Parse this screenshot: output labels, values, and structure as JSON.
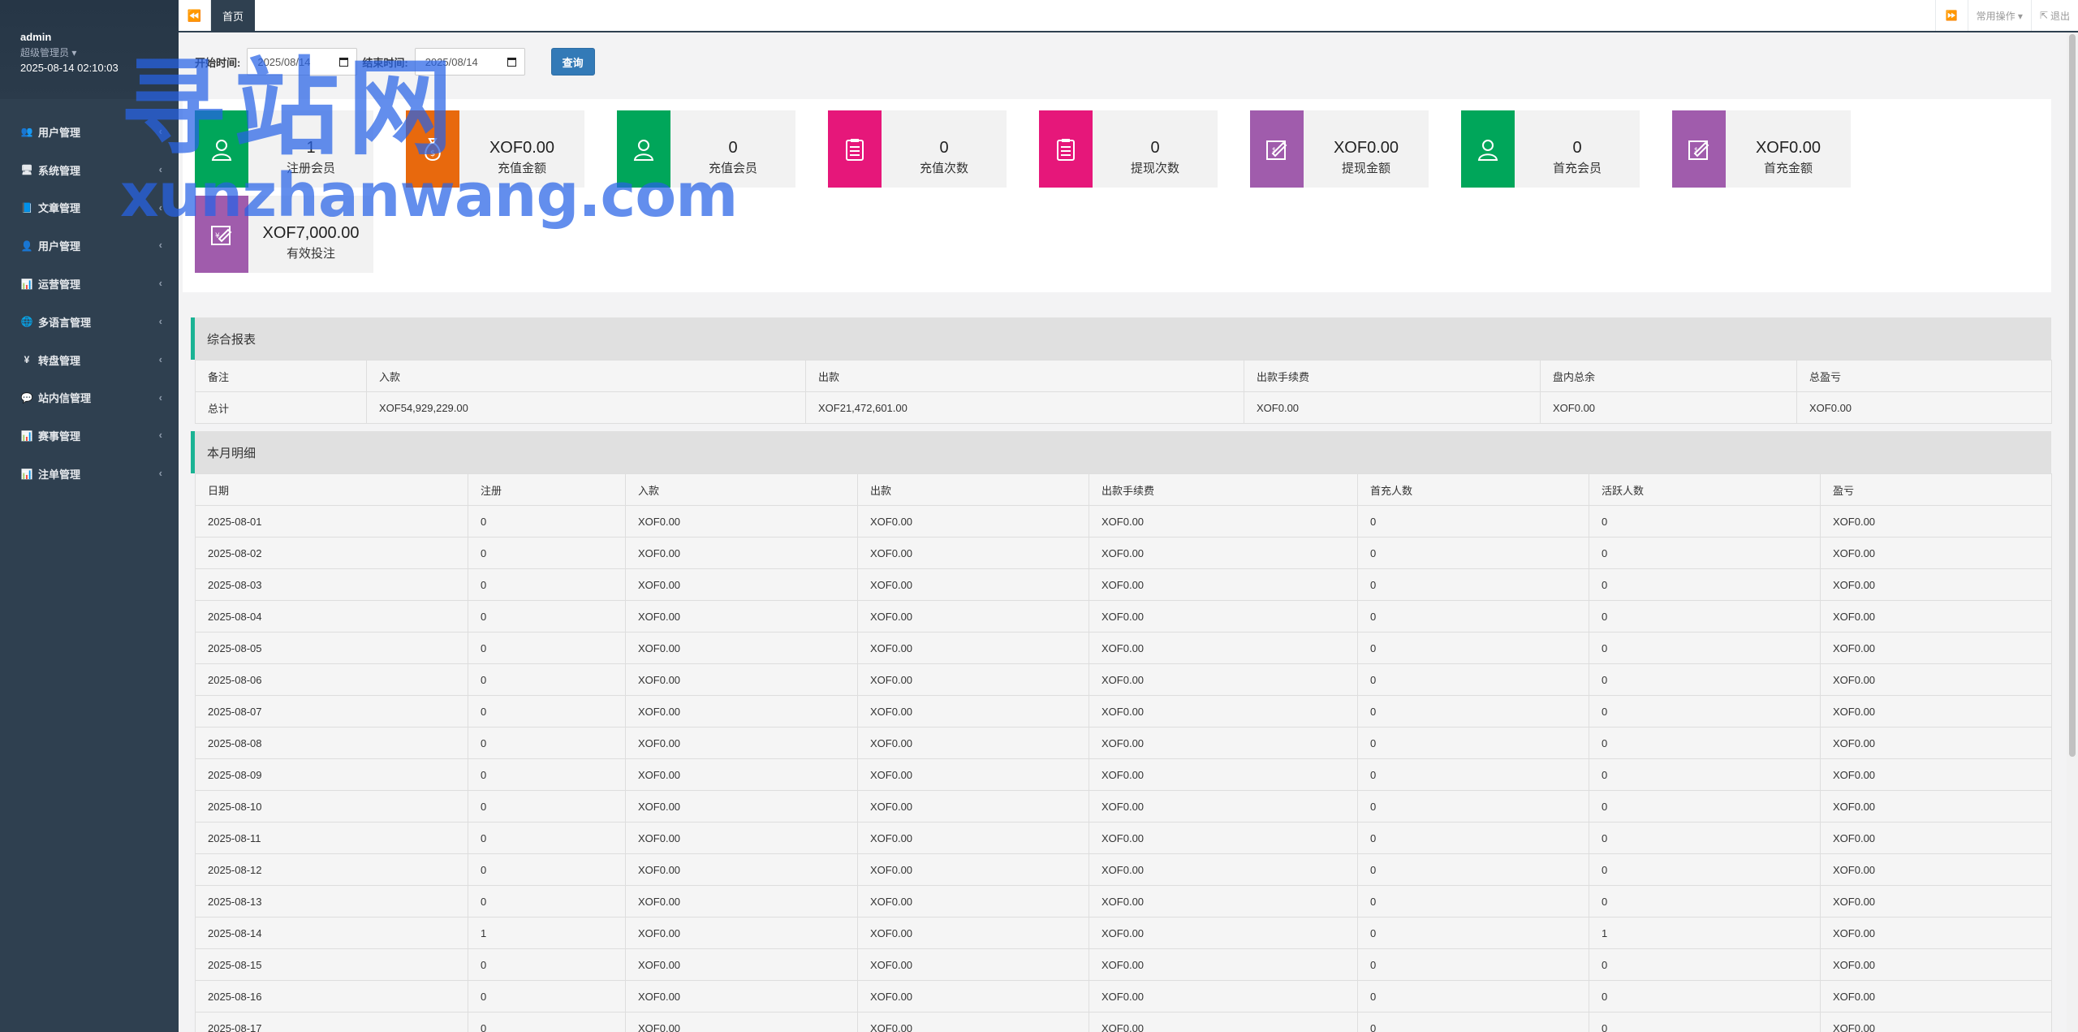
{
  "profile": {
    "name": "admin",
    "role": "超级管理员 ▾",
    "datetime": "2025-08-14 02:10:03"
  },
  "sidebar": {
    "items": [
      {
        "label": "用户管理",
        "icon": "users-icon"
      },
      {
        "label": "系统管理",
        "icon": "desktop-icon"
      },
      {
        "label": "文章管理",
        "icon": "book-icon"
      },
      {
        "label": "用户管理",
        "icon": "user-icon"
      },
      {
        "label": "运营管理",
        "icon": "bar-chart-icon"
      },
      {
        "label": "多语言管理",
        "icon": "globe-icon"
      },
      {
        "label": "转盘管理",
        "icon": "yen-icon"
      },
      {
        "label": "站内信管理",
        "icon": "comment-icon"
      },
      {
        "label": "赛事管理",
        "icon": "bar-chart-icon"
      },
      {
        "label": "注单管理",
        "icon": "bar-chart-icon"
      }
    ]
  },
  "topbar": {
    "back_icon": "double-left-icon",
    "tab": "首页",
    "forward_icon": "double-right-icon",
    "ops": "常用操作 ▾",
    "logout": "退出"
  },
  "search": {
    "start_label": "开始时间:",
    "start_value": "2025/08/14",
    "end_label": "结束时间:",
    "end_value": "2025/08/14",
    "query": "查询"
  },
  "stats": [
    {
      "value": "1",
      "label": "注册会员",
      "color": "#00a65a",
      "icon": "user-icon"
    },
    {
      "value": "XOF0.00",
      "label": "充值金额",
      "color": "#e8690d",
      "icon": "money-bag-icon"
    },
    {
      "value": "0",
      "label": "充值会员",
      "color": "#00a65a",
      "icon": "user-icon"
    },
    {
      "value": "0",
      "label": "充值次数",
      "color": "#e6177a",
      "icon": "clipboard-icon"
    },
    {
      "value": "0",
      "label": "提现次数",
      "color": "#e6177a",
      "icon": "clipboard-icon"
    },
    {
      "value": "XOF0.00",
      "label": "提现金额",
      "color": "#a05cac",
      "icon": "edit-icon"
    },
    {
      "value": "0",
      "label": "首充会员",
      "color": "#00a65a",
      "icon": "user-icon"
    },
    {
      "value": "XOF0.00",
      "label": "首充金额",
      "color": "#a05cac",
      "icon": "edit-icon"
    },
    {
      "value": "XOF7,000.00",
      "label": "有效投注",
      "color": "#a05cac",
      "icon": "yen-edit-icon"
    }
  ],
  "summary": {
    "title": "综合报表",
    "headers": [
      "备注",
      "入款",
      "出款",
      "出款手续费",
      "盘内总余",
      "总盈亏"
    ],
    "rows": [
      [
        "总计",
        "XOF54,929,229.00",
        "XOF21,472,601.00",
        "XOF0.00",
        "XOF0.00",
        "XOF0.00"
      ]
    ]
  },
  "monthly": {
    "title": "本月明细",
    "headers": [
      "日期",
      "注册",
      "入款",
      "出款",
      "出款手续费",
      "首充人数",
      "活跃人数",
      "盈亏"
    ],
    "rows": [
      [
        "2025-08-01",
        "0",
        "XOF0.00",
        "XOF0.00",
        "XOF0.00",
        "0",
        "0",
        "XOF0.00"
      ],
      [
        "2025-08-02",
        "0",
        "XOF0.00",
        "XOF0.00",
        "XOF0.00",
        "0",
        "0",
        "XOF0.00"
      ],
      [
        "2025-08-03",
        "0",
        "XOF0.00",
        "XOF0.00",
        "XOF0.00",
        "0",
        "0",
        "XOF0.00"
      ],
      [
        "2025-08-04",
        "0",
        "XOF0.00",
        "XOF0.00",
        "XOF0.00",
        "0",
        "0",
        "XOF0.00"
      ],
      [
        "2025-08-05",
        "0",
        "XOF0.00",
        "XOF0.00",
        "XOF0.00",
        "0",
        "0",
        "XOF0.00"
      ],
      [
        "2025-08-06",
        "0",
        "XOF0.00",
        "XOF0.00",
        "XOF0.00",
        "0",
        "0",
        "XOF0.00"
      ],
      [
        "2025-08-07",
        "0",
        "XOF0.00",
        "XOF0.00",
        "XOF0.00",
        "0",
        "0",
        "XOF0.00"
      ],
      [
        "2025-08-08",
        "0",
        "XOF0.00",
        "XOF0.00",
        "XOF0.00",
        "0",
        "0",
        "XOF0.00"
      ],
      [
        "2025-08-09",
        "0",
        "XOF0.00",
        "XOF0.00",
        "XOF0.00",
        "0",
        "0",
        "XOF0.00"
      ],
      [
        "2025-08-10",
        "0",
        "XOF0.00",
        "XOF0.00",
        "XOF0.00",
        "0",
        "0",
        "XOF0.00"
      ],
      [
        "2025-08-11",
        "0",
        "XOF0.00",
        "XOF0.00",
        "XOF0.00",
        "0",
        "0",
        "XOF0.00"
      ],
      [
        "2025-08-12",
        "0",
        "XOF0.00",
        "XOF0.00",
        "XOF0.00",
        "0",
        "0",
        "XOF0.00"
      ],
      [
        "2025-08-13",
        "0",
        "XOF0.00",
        "XOF0.00",
        "XOF0.00",
        "0",
        "0",
        "XOF0.00"
      ],
      [
        "2025-08-14",
        "1",
        "XOF0.00",
        "XOF0.00",
        "XOF0.00",
        "0",
        "1",
        "XOF0.00"
      ],
      [
        "2025-08-15",
        "0",
        "XOF0.00",
        "XOF0.00",
        "XOF0.00",
        "0",
        "0",
        "XOF0.00"
      ],
      [
        "2025-08-16",
        "0",
        "XOF0.00",
        "XOF0.00",
        "XOF0.00",
        "0",
        "0",
        "XOF0.00"
      ],
      [
        "2025-08-17",
        "0",
        "XOF0.00",
        "XOF0.00",
        "XOF0.00",
        "0",
        "0",
        "XOF0.00"
      ]
    ]
  },
  "watermark": {
    "big": "寻站网",
    "small": "xunzhanwang.com"
  }
}
